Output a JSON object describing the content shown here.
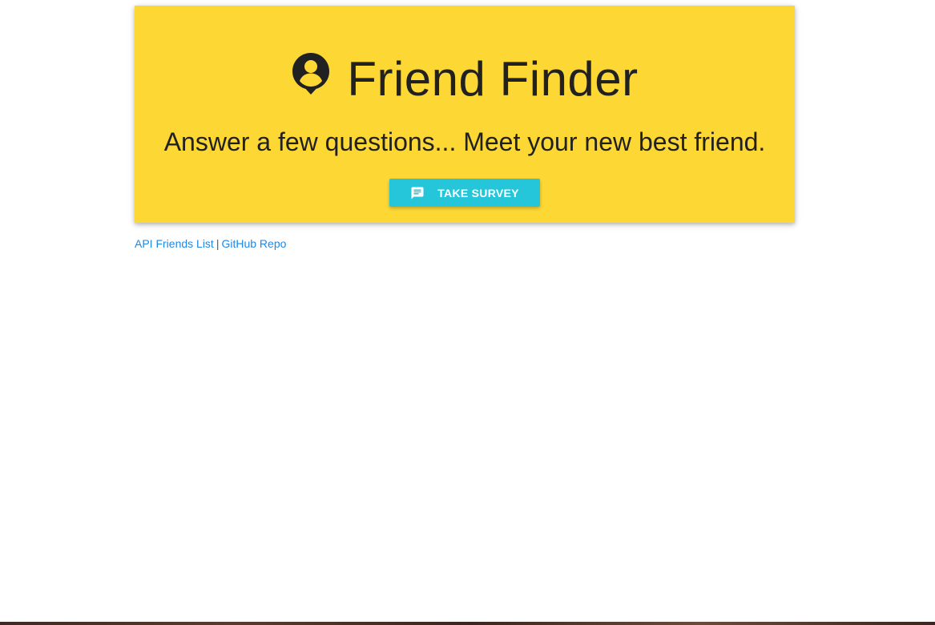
{
  "header": {
    "title": "Friend Finder",
    "title_icon": "account-circle-icon",
    "subtitle": "Answer a few questions... Meet your new best friend.",
    "background_color": "#fdd835"
  },
  "survey_button": {
    "label": "TAKE SURVEY",
    "icon": "chat-message-icon",
    "color": "#26c6da"
  },
  "footer_links": {
    "api_friends_label": "API Friends List",
    "separator": "|",
    "github_label": "GitHub Repo",
    "link_color": "#1e88e5"
  }
}
